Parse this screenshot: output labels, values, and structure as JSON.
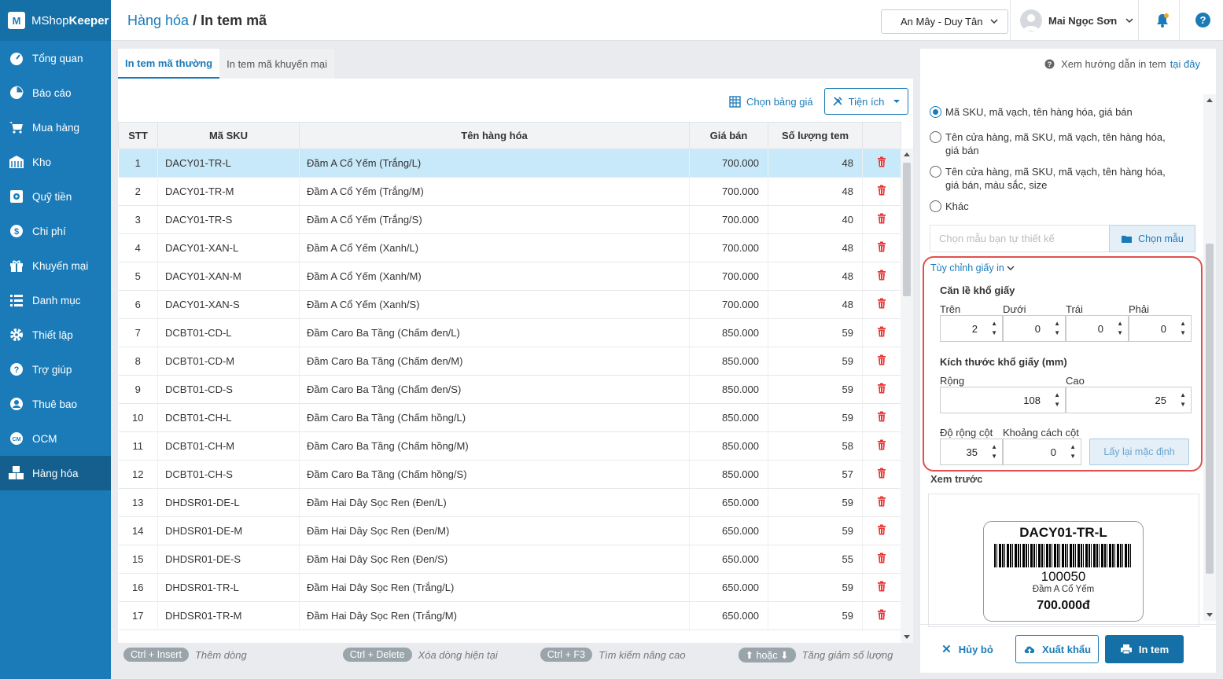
{
  "app": {
    "brand_regular": "MShop",
    "brand_bold": "Keeper"
  },
  "sidebar": {
    "items": [
      {
        "label": "Tổng quan",
        "icon": "dashboard-icon"
      },
      {
        "label": "Báo cáo",
        "icon": "pie-chart-icon"
      },
      {
        "label": "Mua hàng",
        "icon": "cart-icon"
      },
      {
        "label": "Kho",
        "icon": "warehouse-icon"
      },
      {
        "label": "Quỹ tiền",
        "icon": "safe-icon"
      },
      {
        "label": "Chi phí",
        "icon": "money-icon"
      },
      {
        "label": "Khuyến mại",
        "icon": "gift-icon"
      },
      {
        "label": "Danh mục",
        "icon": "list-icon"
      },
      {
        "label": "Thiết lập",
        "icon": "gear-icon"
      },
      {
        "label": "Trợ giúp",
        "icon": "help-icon"
      },
      {
        "label": "Thuê bao",
        "icon": "user-icon"
      },
      {
        "label": "OCM",
        "icon": "ocm-icon"
      },
      {
        "label": "Hàng hóa",
        "icon": "boxes-icon",
        "active": true
      }
    ]
  },
  "header": {
    "breadcrumb_parent": "Hàng hóa",
    "breadcrumb_sep": " / ",
    "breadcrumb_current": "In tem mã",
    "store": "An Mây - Duy Tân",
    "user_name": "Mai Ngọc Sơn"
  },
  "tabs": [
    {
      "label": "In tem mã thường",
      "active": true
    },
    {
      "label": "In tem mã khuyến mại",
      "active": false
    }
  ],
  "toolbar": {
    "price_table_label": "Chọn bảng giá",
    "utility_label": "Tiện ích"
  },
  "table": {
    "headers": {
      "stt": "STT",
      "sku": "Mã SKU",
      "name": "Tên hàng hóa",
      "price": "Giá bán",
      "qty": "Số lượng tem"
    },
    "rows": [
      {
        "stt": "1",
        "sku": "DACY01-TR-L",
        "name": "Đầm A Cổ Yếm (Trắng/L)",
        "price": "700.000",
        "qty": "48"
      },
      {
        "stt": "2",
        "sku": "DACY01-TR-M",
        "name": "Đầm A Cổ Yếm (Trắng/M)",
        "price": "700.000",
        "qty": "48"
      },
      {
        "stt": "3",
        "sku": "DACY01-TR-S",
        "name": "Đầm A Cổ Yếm (Trắng/S)",
        "price": "700.000",
        "qty": "40"
      },
      {
        "stt": "4",
        "sku": "DACY01-XAN-L",
        "name": "Đầm A Cổ Yếm (Xanh/L)",
        "price": "700.000",
        "qty": "48"
      },
      {
        "stt": "5",
        "sku": "DACY01-XAN-M",
        "name": "Đầm A Cổ Yếm (Xanh/M)",
        "price": "700.000",
        "qty": "48"
      },
      {
        "stt": "6",
        "sku": "DACY01-XAN-S",
        "name": "Đầm A Cổ Yếm (Xanh/S)",
        "price": "700.000",
        "qty": "48"
      },
      {
        "stt": "7",
        "sku": "DCBT01-CD-L",
        "name": "Đầm Caro Ba Tầng (Chấm đen/L)",
        "price": "850.000",
        "qty": "59"
      },
      {
        "stt": "8",
        "sku": "DCBT01-CD-M",
        "name": "Đầm Caro Ba Tầng (Chấm đen/M)",
        "price": "850.000",
        "qty": "59"
      },
      {
        "stt": "9",
        "sku": "DCBT01-CD-S",
        "name": "Đầm Caro Ba Tầng (Chấm đen/S)",
        "price": "850.000",
        "qty": "59"
      },
      {
        "stt": "10",
        "sku": "DCBT01-CH-L",
        "name": "Đầm Caro Ba Tầng (Chấm hồng/L)",
        "price": "850.000",
        "qty": "59"
      },
      {
        "stt": "11",
        "sku": "DCBT01-CH-M",
        "name": "Đầm Caro Ba Tầng (Chấm hồng/M)",
        "price": "850.000",
        "qty": "58"
      },
      {
        "stt": "12",
        "sku": "DCBT01-CH-S",
        "name": "Đầm Caro Ba Tầng (Chấm hồng/S)",
        "price": "850.000",
        "qty": "57"
      },
      {
        "stt": "13",
        "sku": "DHDSR01-DE-L",
        "name": "Đầm Hai Dây Sọc Ren (Đen/L)",
        "price": "650.000",
        "qty": "59"
      },
      {
        "stt": "14",
        "sku": "DHDSR01-DE-M",
        "name": "Đầm Hai Dây Sọc Ren (Đen/M)",
        "price": "650.000",
        "qty": "59"
      },
      {
        "stt": "15",
        "sku": "DHDSR01-DE-S",
        "name": "Đầm Hai Dây Sọc Ren (Đen/S)",
        "price": "650.000",
        "qty": "55"
      },
      {
        "stt": "16",
        "sku": "DHDSR01-TR-L",
        "name": "Đầm Hai Dây Sọc Ren (Trắng/L)",
        "price": "650.000",
        "qty": "59"
      },
      {
        "stt": "17",
        "sku": "DHDSR01-TR-M",
        "name": "Đầm Hai Dây Sọc Ren (Trắng/M)",
        "price": "650.000",
        "qty": "59"
      }
    ]
  },
  "shortcuts": [
    {
      "key": "Ctrl + Insert",
      "desc": "Thêm dòng"
    },
    {
      "key": "Ctrl + Delete",
      "desc": "Xóa dòng hiện tại"
    },
    {
      "key": "Ctrl + F3",
      "desc": "Tìm kiếm nâng cao"
    },
    {
      "key": "hoặc",
      "desc": "Tăng giảm số lượng"
    }
  ],
  "right_panel": {
    "guide_text": "Xem hướng dẫn in tem",
    "guide_link": "tại đây",
    "options": [
      {
        "label": "Mã SKU, mã vạch, tên hàng hóa, giá bán",
        "checked": true
      },
      {
        "label": "Tên cửa hàng, mã SKU, mã vạch, tên hàng hóa, giá bán",
        "checked": false
      },
      {
        "label": "Tên cửa hàng, mã SKU, mã vạch, tên hàng hóa, giá bán, màu sắc, size",
        "checked": false
      },
      {
        "label": "Khác",
        "checked": false
      }
    ],
    "template_placeholder": "Chọn mẫu bạn tự thiết kế",
    "template_button": "Chọn mẫu",
    "custom_title": "Tùy chỉnh giấy in",
    "margin_title": "Căn lề khổ giấy",
    "margins": {
      "top_label": "Trên",
      "top": "2",
      "bottom_label": "Dưới",
      "bottom": "0",
      "left_label": "Trái",
      "left": "0",
      "right_label": "Phải",
      "right": "0"
    },
    "size_title": "Kích thước khổ giấy (mm)",
    "size": {
      "width_label": "Rộng",
      "width": "108",
      "height_label": "Cao",
      "height": "25"
    },
    "column": {
      "width_label": "Độ rộng cột",
      "width": "35",
      "gap_label": "Khoảng cách cột",
      "gap": "0"
    },
    "reset_button": "Lấy lại mặc định",
    "preview_title": "Xem trước",
    "preview": {
      "sku": "DACY01-TR-L",
      "code": "100050",
      "name": "Đầm A Cổ Yếm",
      "price": "700.000đ"
    },
    "cancel_button": "Hủy bỏ",
    "export_button": "Xuất khẩu",
    "print_button": "In tem"
  },
  "colors": {
    "primary": "#1b7bb8",
    "sidebar": "#1b7bb8",
    "selected_row": "#c8e9f9",
    "delete": "#e53935",
    "highlight_border": "#e05050"
  }
}
